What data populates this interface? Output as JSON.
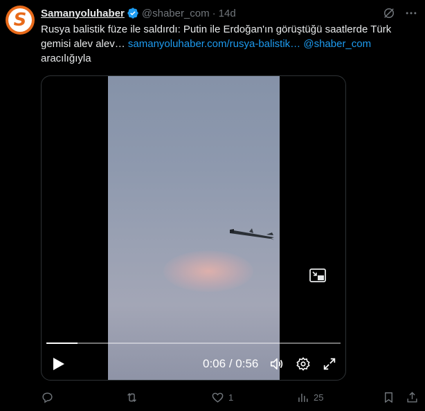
{
  "post": {
    "author_name": "Samanyoluhaber",
    "handle": "@shaber_com",
    "separator": "·",
    "time": "14d",
    "avatar_letter": "S",
    "text_plain": "Rusya balistik füze ile saldırdı: Putin ile Erdoğan'ın görüştüğü saatlerde Türk gemisi alev alev… ",
    "link_text": "samanyoluhaber.com/rusya-balistik…",
    "via_handle": "@shaber_com",
    "via_suffix": "aracılığıyla"
  },
  "video": {
    "current_time": "0:06",
    "time_separator": "/",
    "duration": "0:56",
    "progress_fraction": 0.107
  },
  "actions": {
    "replies": "",
    "reposts": "",
    "likes": "1",
    "views": "25"
  },
  "colors": {
    "accent": "#1d9bf0",
    "muted": "#71767b",
    "brand_orange": "#e86a1a",
    "background": "#000000"
  },
  "icons": [
    "verified-badge-icon",
    "grok-icon",
    "more-icon",
    "pip-icon",
    "play-icon",
    "volume-icon",
    "settings-icon",
    "fullscreen-icon",
    "reply-icon",
    "repost-icon",
    "like-icon",
    "views-icon",
    "bookmark-icon",
    "share-icon"
  ]
}
